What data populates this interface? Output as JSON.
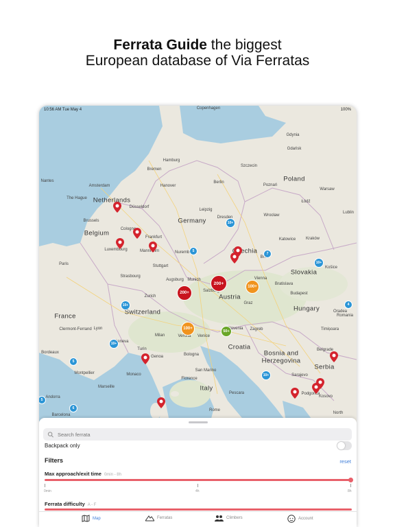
{
  "headline": {
    "bold": "Ferrata Guide",
    "rest1": " the biggest",
    "line2": "European database of Via Ferratas"
  },
  "status_bar": {
    "time_date": "10:56 AM   Tue May 4",
    "battery": "100%"
  },
  "map": {
    "countries": [
      {
        "name": "Germany"
      },
      {
        "name": "Poland"
      },
      {
        "name": "France"
      },
      {
        "name": "Austria"
      },
      {
        "name": "Italy"
      },
      {
        "name": "Switzerland"
      },
      {
        "name": "Netherlands"
      },
      {
        "name": "Belgium"
      },
      {
        "name": "Slovakia"
      },
      {
        "name": "Hungary"
      },
      {
        "name": "Croatia"
      },
      {
        "name": "Serbia"
      },
      {
        "name": "Bosnia and"
      },
      {
        "name": "Herzegovina"
      },
      {
        "name": "Czechia"
      },
      {
        "name": "Luxembourg"
      },
      {
        "name": "Slovenia"
      },
      {
        "name": "Romania"
      },
      {
        "name": "Kosovo"
      }
    ],
    "cities": [
      "Copenhagen",
      "Gdynia",
      "Gdańsk",
      "Hamburg",
      "Szczecin",
      "Bremen",
      "Amsterdam",
      "Hanover",
      "Berlin",
      "Poznań",
      "Warsaw",
      "The Hague",
      "Düsseldorf",
      "Leipzig",
      "Dresden",
      "Wrocław",
      "Łódź",
      "Brussels",
      "Cologne",
      "Frankfurt",
      "Lublin",
      "Katowice",
      "Kraków",
      "Mannheim",
      "Nuremberg",
      "Brno",
      "Stuttgart",
      "Paris",
      "Strasbourg",
      "Augsburg",
      "Munich",
      "Vienna",
      "Bratislava",
      "Košice",
      "Zurich",
      "Salzburg",
      "Budapest",
      "Graz",
      "Lyon",
      "Geneva",
      "Milan",
      "Verona",
      "Venice",
      "Zagreb",
      "Timișoara",
      "Clermont-Ferrand",
      "Turin",
      "Genoa",
      "Bologna",
      "Belgrade",
      "Florence",
      "Montpellier",
      "Monaco",
      "Marseille",
      "San Marino",
      "Sarajevo",
      "Rome",
      "Pescara",
      "Andorra",
      "Barcelona",
      "Podgorica",
      "North",
      "Nantes",
      "Bordeaux",
      "Oradea"
    ],
    "clusters": [
      {
        "label": "200+",
        "color": "#c8141e"
      },
      {
        "label": "200+",
        "color": "#c8141e"
      },
      {
        "label": "100+",
        "color": "#f0931e"
      },
      {
        "label": "100+",
        "color": "#f0931e"
      },
      {
        "label": "50+",
        "color": "#6aa628"
      },
      {
        "label": "10+",
        "color": "#2b95d6"
      },
      {
        "label": "10+",
        "color": "#2b95d6"
      },
      {
        "label": "10+",
        "color": "#2b95d6"
      },
      {
        "label": "10+",
        "color": "#2b95d6"
      },
      {
        "label": "10+",
        "color": "#2b95d6"
      },
      {
        "label": "5",
        "color": "#2b95d6"
      },
      {
        "label": "7",
        "color": "#2b95d6"
      },
      {
        "label": "4",
        "color": "#2b95d6"
      },
      {
        "label": "5",
        "color": "#2b95d6"
      },
      {
        "label": "6",
        "color": "#2b95d6"
      },
      {
        "label": "5",
        "color": "#2b95d6"
      }
    ],
    "pin_color": "#d4232d"
  },
  "sheet": {
    "search_placeholder": "Search ferrata",
    "backpack_label": "Backpack only",
    "filters_title": "Filters",
    "reset_label": "reset",
    "approach": {
      "label": "Max approach/exit time",
      "range": "0min - 8h",
      "ticks": [
        "0min",
        "4h",
        "8h"
      ],
      "value_fraction": 1.0
    },
    "difficulty": {
      "label": "Ferrata difficulty",
      "range": "A - F"
    }
  },
  "tabs": [
    {
      "label": "Map",
      "icon": "map-icon"
    },
    {
      "label": "Ferratas",
      "icon": "mountain-icon"
    },
    {
      "label": "Climbers",
      "icon": "people-icon"
    },
    {
      "label": "Account",
      "icon": "face-icon"
    }
  ]
}
